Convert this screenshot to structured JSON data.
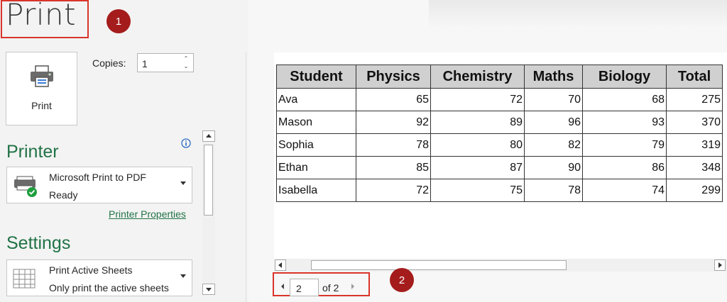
{
  "header": {
    "title": "Print"
  },
  "callouts": [
    {
      "number": "1"
    },
    {
      "number": "2"
    }
  ],
  "print_button": {
    "label": "Print",
    "icon": "printer-icon"
  },
  "copies": {
    "label": "Copies:",
    "value": "1"
  },
  "printer": {
    "section_title": "Printer",
    "name": "Microsoft Print to PDF",
    "status": "Ready",
    "properties_link": "Printer Properties"
  },
  "settings": {
    "section_title": "Settings",
    "option_title": "Print Active Sheets",
    "option_desc": "Only print the active sheets"
  },
  "preview_table": {
    "headers": [
      "Student",
      "Physics",
      "Chemistry",
      "Maths",
      "Biology",
      "Total"
    ],
    "rows": [
      [
        "Ava",
        "65",
        "72",
        "70",
        "68",
        "275"
      ],
      [
        "Mason",
        "92",
        "89",
        "96",
        "93",
        "370"
      ],
      [
        "Sophia",
        "78",
        "80",
        "82",
        "79",
        "319"
      ],
      [
        "Ethan",
        "85",
        "87",
        "90",
        "86",
        "348"
      ],
      [
        "Isabella",
        "72",
        "75",
        "78",
        "74",
        "299"
      ]
    ]
  },
  "pager": {
    "current": "2",
    "of_label": "of 2"
  },
  "colors": {
    "accent": "#217346",
    "callout": "#a51c1c",
    "callout_border": "#d9342b"
  }
}
